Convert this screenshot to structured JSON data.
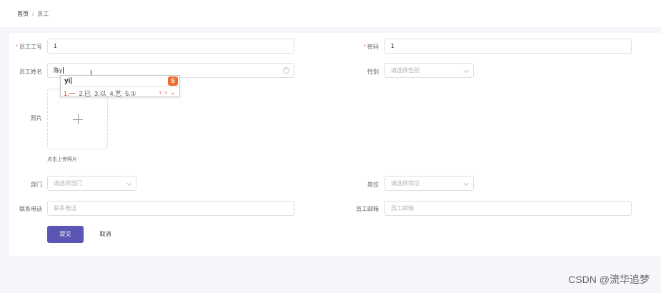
{
  "breadcrumb": {
    "home": "首页",
    "separator": "/",
    "current": "员工"
  },
  "form": {
    "employee_no": {
      "label": "员工工号",
      "value": "1",
      "required": true
    },
    "password": {
      "label": "密码",
      "value": "1",
      "required": true
    },
    "name": {
      "label": "员工姓名",
      "value": "陈y",
      "clear_icon": "circle-close-icon"
    },
    "gender": {
      "label": "性别",
      "placeholder": "请选择性别"
    },
    "photo": {
      "label": "照片",
      "hint": "点击上传照片",
      "icon": "plus-icon"
    },
    "department": {
      "label": "部门",
      "placeholder": "请选择部门"
    },
    "position": {
      "label": "岗位",
      "placeholder": "请选择岗位"
    },
    "phone": {
      "label": "联系电话",
      "placeholder": "联系电话"
    },
    "email": {
      "label": "员工邮箱",
      "placeholder": "员工邮箱"
    },
    "required_mark": "*"
  },
  "buttons": {
    "submit": "提交",
    "cancel": "取消"
  },
  "ime": {
    "composition": "yi",
    "candidates": [
      "1.一",
      "2.已",
      "3.以",
      "4.艺",
      "5.①"
    ],
    "nav": "‹ › ⌄",
    "logo": "S"
  },
  "colors": {
    "primary": "#5b55b3",
    "required": "#f56c6c",
    "ime_accent": "#e0442b"
  },
  "watermark": "CSDN @流华追梦"
}
